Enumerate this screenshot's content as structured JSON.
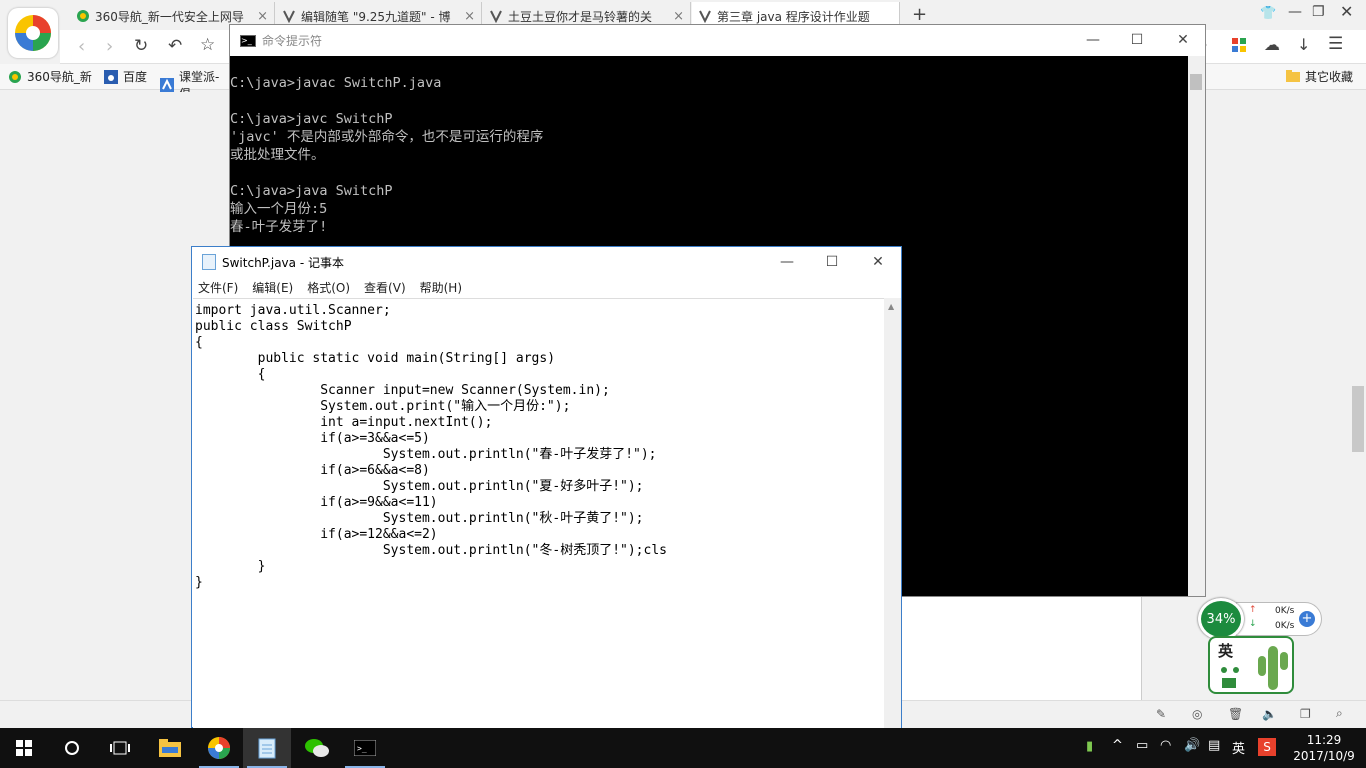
{
  "browser": {
    "tabs": [
      {
        "title": "360导航_新一代安全上网导"
      },
      {
        "title": "编辑随笔 \"9.25九道题\" - 博"
      },
      {
        "title": "土豆土豆你才是马铃薯的关"
      },
      {
        "title": "第三章 java 程序设计作业题"
      }
    ],
    "new_tab": "+",
    "bookmarks": [
      "360导航_新",
      "百度",
      "课堂派-倡"
    ],
    "other_bookmarks": "其它收藏"
  },
  "cmd": {
    "title": "命令提示符",
    "lines": [
      "C:\\java>javac SwitchP.java",
      "",
      "C:\\java>javc SwitchP",
      "'javc' 不是内部或外部命令，也不是可运行的程序",
      "或批处理文件。",
      "",
      "C:\\java>java SwitchP",
      "输入一个月份:5",
      "春-叶子发芽了!"
    ]
  },
  "notepad": {
    "title": "SwitchP.java - 记事本",
    "menu": [
      "文件(F)",
      "编辑(E)",
      "格式(O)",
      "查看(V)",
      "帮助(H)"
    ],
    "code": [
      "import java.util.Scanner;",
      "public class SwitchP",
      "{",
      "        public static void main(String[] args)",
      "        {",
      "                Scanner input=new Scanner(System.in);",
      "                System.out.print(\"输入一个月份:\");",
      "                int a=input.nextInt();",
      "                if(a>=3&&a<=5)",
      "                        System.out.println(\"春-叶子发芽了!\");",
      "                if(a>=6&&a<=8)",
      "                        System.out.println(\"夏-好多叶子!\");",
      "                if(a>=9&&a<=11)",
      "                        System.out.println(\"秋-叶子黄了!\");",
      "                if(a>=12&&a<=2)",
      "                        System.out.println(\"冬-树秃顶了!\");cls",
      "        }",
      "}"
    ]
  },
  "net_widget": {
    "percent": "34%",
    "up": "0K/s",
    "down": "0K/s"
  },
  "ime": {
    "label": "英"
  },
  "tray": {
    "ime": "英",
    "time": "11:29",
    "date": "2017/10/9"
  },
  "colors": {
    "taskbar": "#101010",
    "cmd_bg": "#000000",
    "accent": "#3c7ec9",
    "net_green": "#1c8b3e"
  }
}
